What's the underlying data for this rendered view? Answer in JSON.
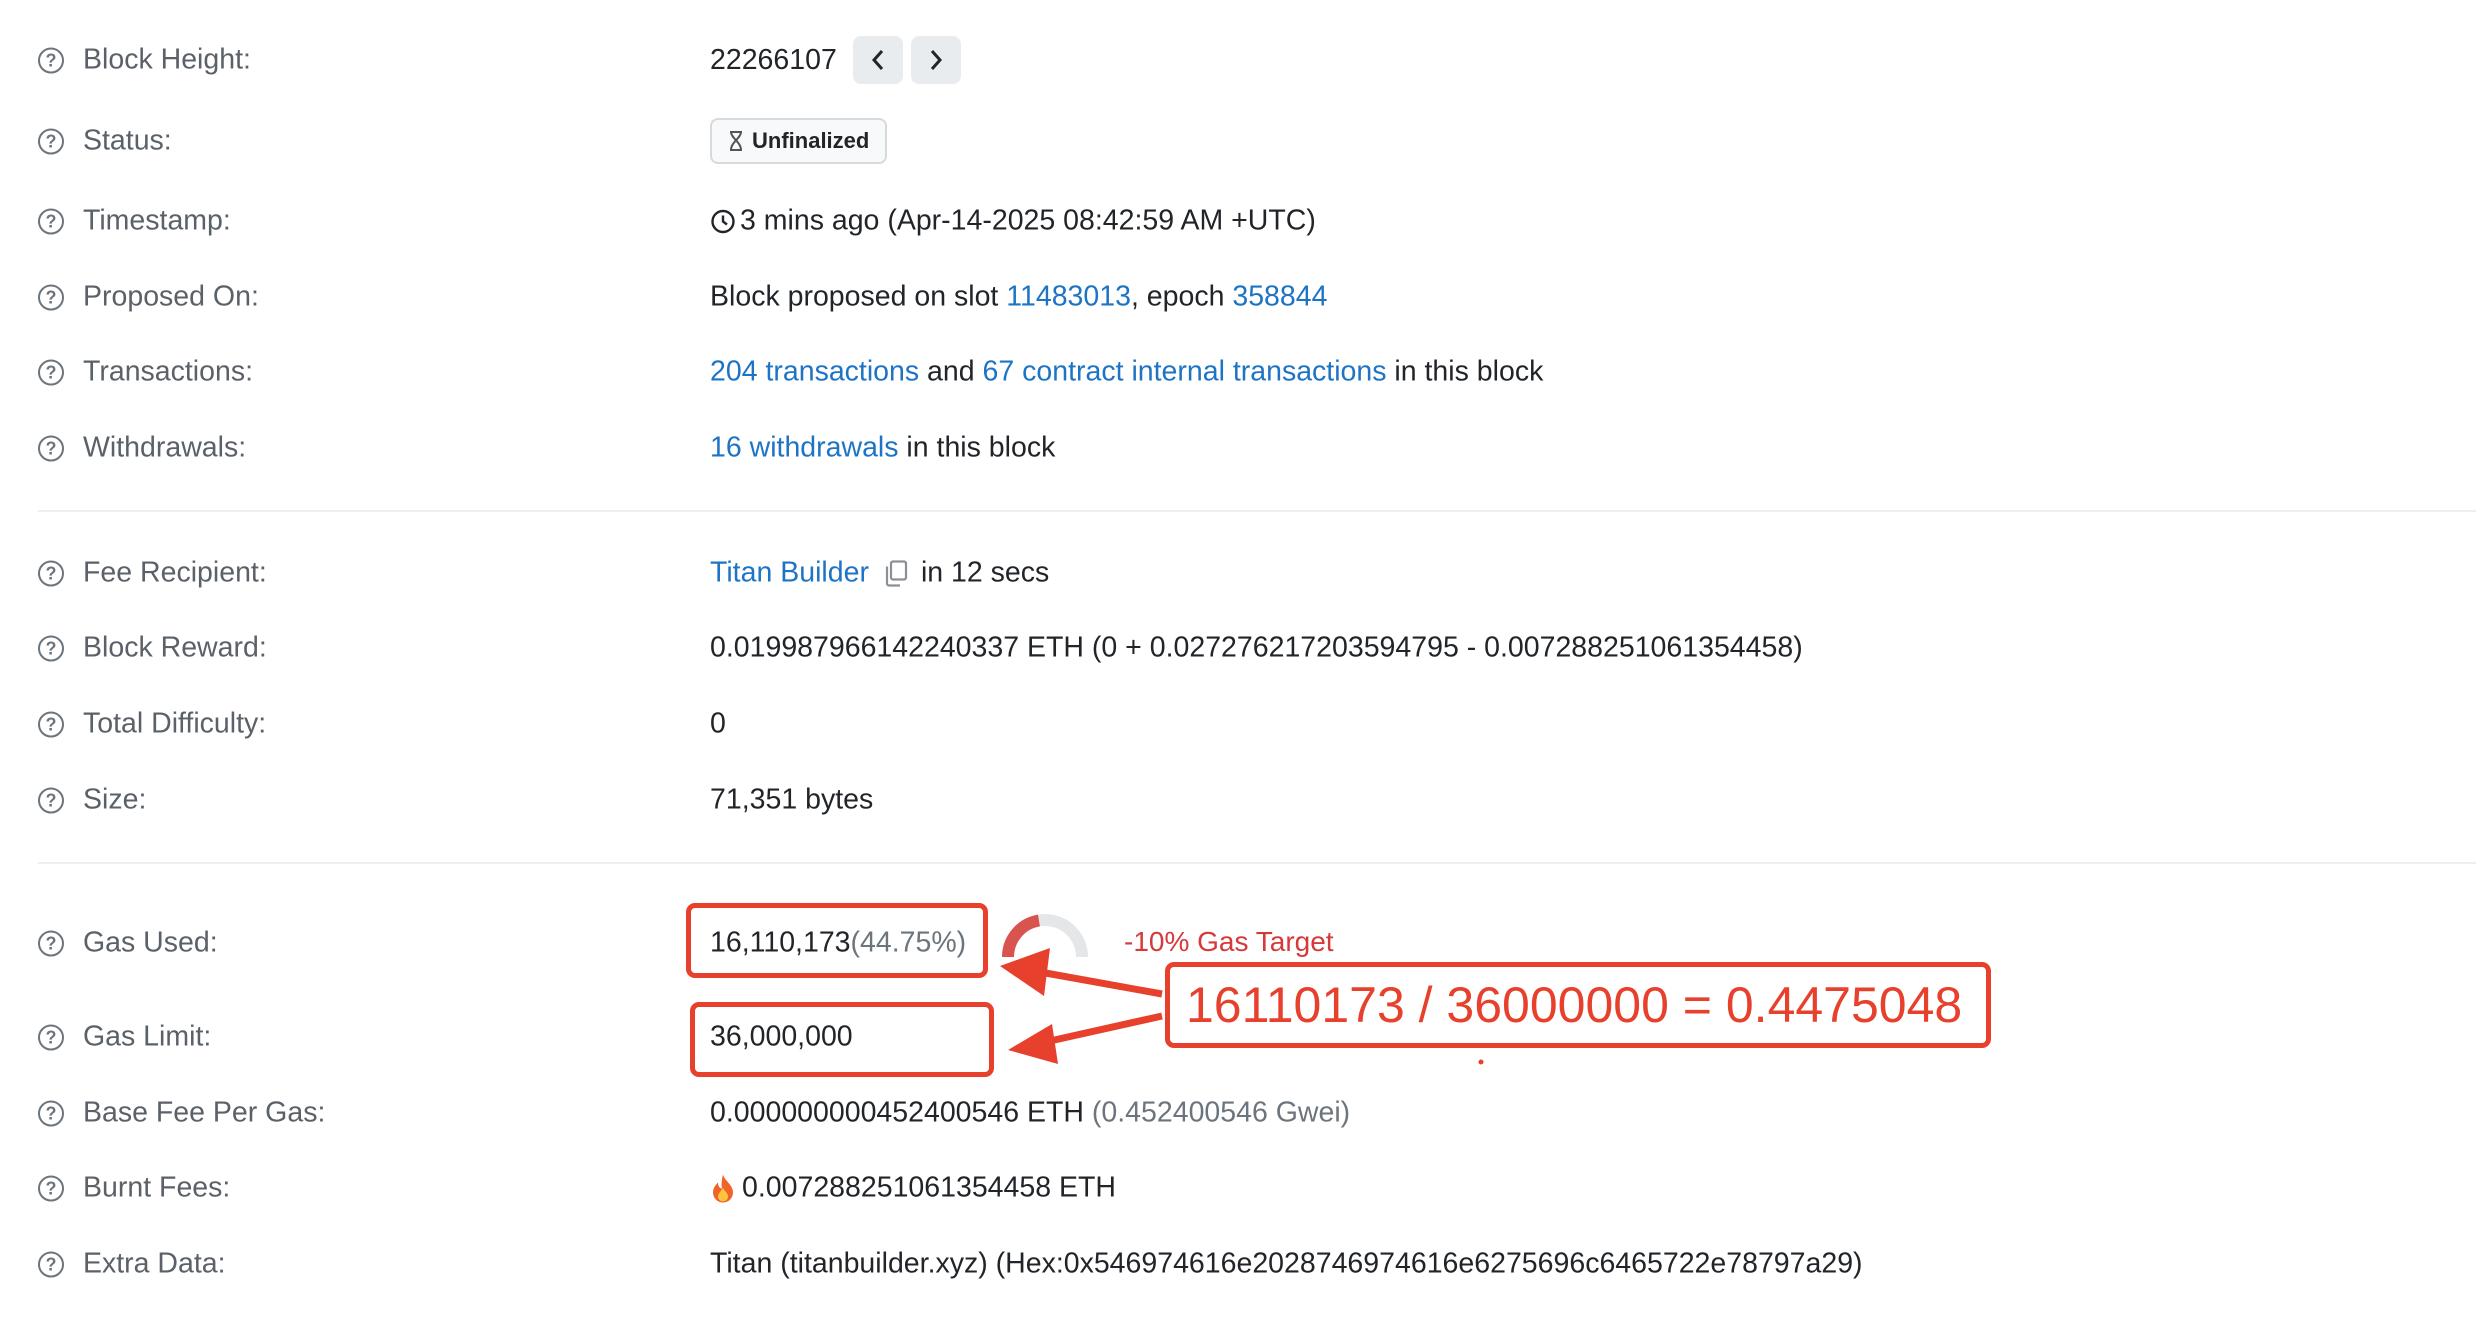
{
  "rows": {
    "block_height": {
      "label": "Block Height:",
      "value": "22266107"
    },
    "status": {
      "label": "Status:",
      "badge": "Unfinalized"
    },
    "timestamp": {
      "label": "Timestamp:",
      "value": "3 mins ago (Apr-14-2025 08:42:59 AM +UTC)"
    },
    "proposed_on": {
      "label": "Proposed On:",
      "prefix": "Block proposed on slot ",
      "slot": "11483013",
      "middle": ", epoch ",
      "epoch": "358844"
    },
    "transactions": {
      "label": "Transactions:",
      "tx_link": "204 transactions",
      "and": " and ",
      "internal_link": "67 contract internal transactions",
      "suffix": " in this block"
    },
    "withdrawals": {
      "label": "Withdrawals:",
      "link": "16 withdrawals",
      "suffix": " in this block"
    },
    "fee_recipient": {
      "label": "Fee Recipient:",
      "link": "Titan Builder",
      "suffix": "in 12 secs"
    },
    "block_reward": {
      "label": "Block Reward:",
      "value": "0.019987966142240337 ETH (0 + 0.027276217203594795 - 0.007288251061354458)"
    },
    "total_difficulty": {
      "label": "Total Difficulty:",
      "value": "0"
    },
    "size": {
      "label": "Size:",
      "value": "71,351 bytes"
    },
    "gas_used": {
      "label": "Gas Used:",
      "value": "16,110,173",
      "percent": "(44.75%)",
      "target": "-10% Gas Target"
    },
    "gas_limit": {
      "label": "Gas Limit:",
      "value": "36,000,000"
    },
    "base_fee": {
      "label": "Base Fee Per Gas:",
      "value": "0.000000000452400546 ETH ",
      "gwei": "(0.452400546 Gwei)"
    },
    "burnt_fees": {
      "label": "Burnt Fees:",
      "value": "0.007288251061354458 ETH"
    },
    "extra_data": {
      "label": "Extra Data:",
      "value": "Titan (titanbuilder.xyz) (Hex:0x546974616e2028746974616e6275696c6465722e78797a29)"
    }
  },
  "annotation": {
    "formula": "16110173 / 36000000 = 0.4475048"
  },
  "gas_used_fraction": 0.4475,
  "colors": {
    "link": "#1e74c4",
    "annotation": "#e7402c",
    "target": "#d63939",
    "gauge_fill": "#d9534f"
  },
  "icons": {
    "help": "question-circle-icon",
    "clock": "clock-icon",
    "hourglass": "hourglass-icon",
    "fire": "fire-icon",
    "copy": "copy-icon"
  }
}
